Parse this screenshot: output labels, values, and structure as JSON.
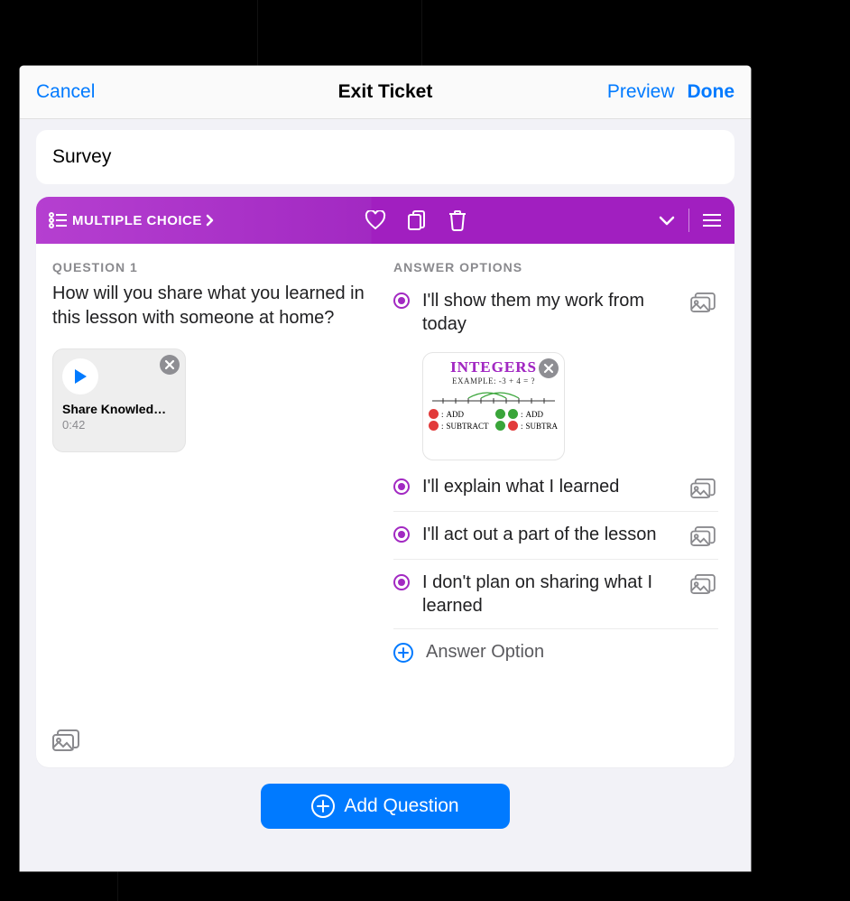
{
  "nav": {
    "cancel": "Cancel",
    "title": "Exit Ticket",
    "preview": "Preview",
    "done": "Done"
  },
  "survey_field": "Survey",
  "header": {
    "type_label": "MULTIPLE CHOICE"
  },
  "question": {
    "label": "QUESTION 1",
    "text": "How will you share what you learned in this lesson with someone at home?",
    "media": {
      "title": "Share Knowled…",
      "duration": "0:42",
      "play_icon": "play-icon"
    }
  },
  "answers": {
    "label": "ANSWER OPTIONS",
    "options": [
      {
        "text": "I'll show them my work from today",
        "has_thumb": true
      },
      {
        "text": "I'll explain what I learned"
      },
      {
        "text": "I'll act out a part of the lesson"
      },
      {
        "text": "I don't plan on sharing what I learned"
      }
    ],
    "add_label": "Answer Option"
  },
  "thumb": {
    "title": "INTEGERS",
    "example": "EXAMPLE: -3 + 4 = ?",
    "labels": [
      "ADD",
      "ADD",
      "SUBTRACT",
      "SUBTRA"
    ]
  },
  "add_question": "Add Question"
}
